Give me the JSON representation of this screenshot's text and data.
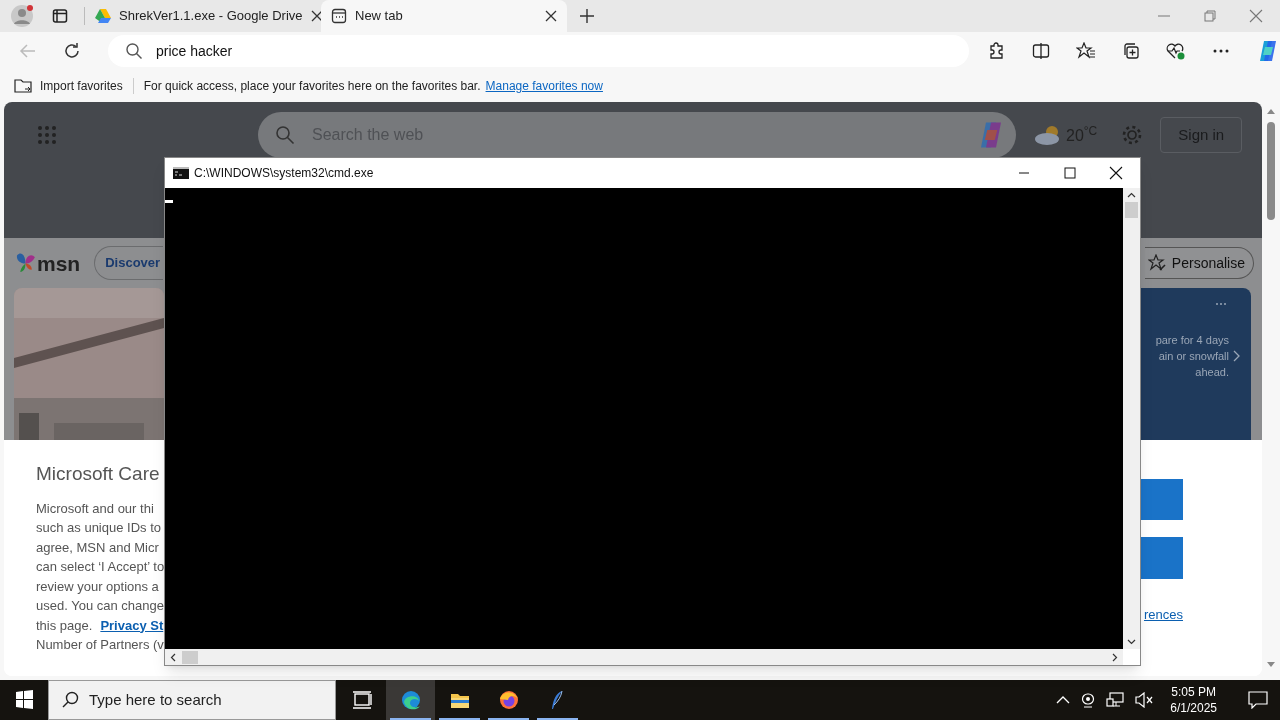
{
  "browser": {
    "tabs": [
      {
        "title": "ShrekVer1.1.exe - Google Drive",
        "kind": "drive",
        "selected": false
      },
      {
        "title": "New tab",
        "kind": "newtab",
        "selected": true
      }
    ],
    "address": "price hacker",
    "favorites_bar": {
      "import": "Import favorites",
      "hint": "For quick access, place your favorites here on the favorites bar.",
      "link": "Manage favorites now"
    }
  },
  "page": {
    "search_placeholder": "Search the web",
    "temperature": "20$^{°C}$",
    "sign_in": "Sign in",
    "logo_text": "msn",
    "nav_pill": "Discover",
    "personalise": "Personalise",
    "weather_card": [
      "pare for 4 days",
      "ain or snowfall",
      "ahead."
    ],
    "consent": {
      "title": "Microsoft Care",
      "lines": [
        {
          "text": "Microsoft and our thi"
        },
        {
          "text": "such as unique IDs to"
        },
        {
          "text": "agree, MSN and Micr"
        },
        {
          "text": "can select ‘I Accept’ to"
        },
        {
          "text": "review your options a"
        },
        {
          "text": "used.  You can change"
        },
        {
          "text": "this page.",
          "link": "Privacy St"
        },
        {
          "text": "Number of Partners (v"
        }
      ],
      "side_link": "rences"
    }
  },
  "cmd": {
    "title": "C:\\WINDOWS\\system32\\cmd.exe"
  },
  "taskbar": {
    "search_placeholder": "Type here to search",
    "apps": [
      {
        "kind": "taskview",
        "selected": false,
        "running": false
      },
      {
        "kind": "edge",
        "selected": true,
        "running": true
      },
      {
        "kind": "explorer",
        "selected": false,
        "running": true
      },
      {
        "kind": "firefox",
        "selected": false,
        "running": true
      },
      {
        "kind": "feather",
        "selected": false,
        "running": true
      }
    ],
    "time": "5:05 PM",
    "date": "6/1/2025"
  }
}
